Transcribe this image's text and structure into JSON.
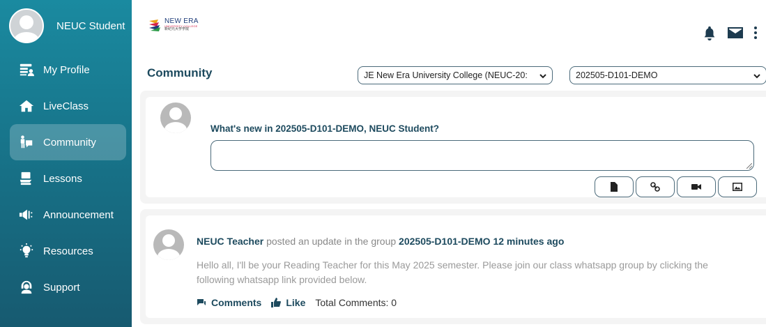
{
  "user": {
    "name": "NEUC Student"
  },
  "logo": {
    "line1": "NEW ERA",
    "line2": "UNIVERSITY COLLEGE",
    "line3": "新纪元大学学院"
  },
  "nav": [
    {
      "label": "My Profile",
      "icon": "profile-card-icon",
      "active": false
    },
    {
      "label": "LiveClass",
      "icon": "home-icon",
      "active": false
    },
    {
      "label": "Community",
      "icon": "community-icon",
      "active": true
    },
    {
      "label": "Lessons",
      "icon": "lessons-icon",
      "active": false
    },
    {
      "label": "Announcement",
      "icon": "megaphone-icon",
      "active": false
    },
    {
      "label": "Resources",
      "icon": "lightbulb-icon",
      "active": false
    },
    {
      "label": "Support",
      "icon": "support-headset-icon",
      "active": false
    }
  ],
  "header": {
    "title": "Community",
    "institution_select": "JE New Era University College (NEUC-20:",
    "group_select": "202505-D101-DEMO"
  },
  "composer": {
    "prompt": "What's new in 202505-D101-DEMO, NEUC Student?",
    "text_value": "",
    "attachments": [
      "file-icon",
      "link-icon",
      "video-icon",
      "image-icon"
    ]
  },
  "feed": [
    {
      "author": "NEUC Teacher",
      "action": "posted an update in the group",
      "group": "202505-D101-DEMO",
      "time": "12 minutes ago",
      "body": "Hello all, I'll be your Reading Teacher for this May 2025 semester. Please join our class whatsapp group by clicking the following whatsapp link provided below.",
      "comments_label": "Comments",
      "like_label": "Like",
      "total_comments": "Total Comments: 0"
    }
  ],
  "colors": {
    "sidebar_top": "#1a8aa0",
    "sidebar_bottom": "#175a70",
    "accent_text": "#1d4a5e"
  }
}
